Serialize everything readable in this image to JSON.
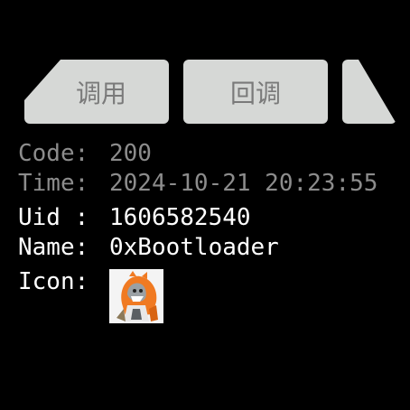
{
  "tabs": [
    {
      "label": "调用"
    },
    {
      "label": "回调"
    },
    {
      "label": ""
    }
  ],
  "info": {
    "code_key": "Code:",
    "code_value": "200",
    "time_key": "Time:",
    "time_value": "2024-10-21 20:23:55",
    "uid_key": "Uid :",
    "uid_value": "1606582540",
    "name_key": "Name:",
    "name_value": "0xBootloader",
    "icon_key": "Icon:"
  },
  "colors": {
    "background": "#000000",
    "tab_bg": "#d6d8d6",
    "tab_text": "#7a7a7a",
    "dim_text": "#8c8c8c",
    "bright_text": "#ffffff",
    "avatar_accent": "#f07a22"
  },
  "avatar": {
    "icon": "orange-hooded-character-avatar"
  }
}
